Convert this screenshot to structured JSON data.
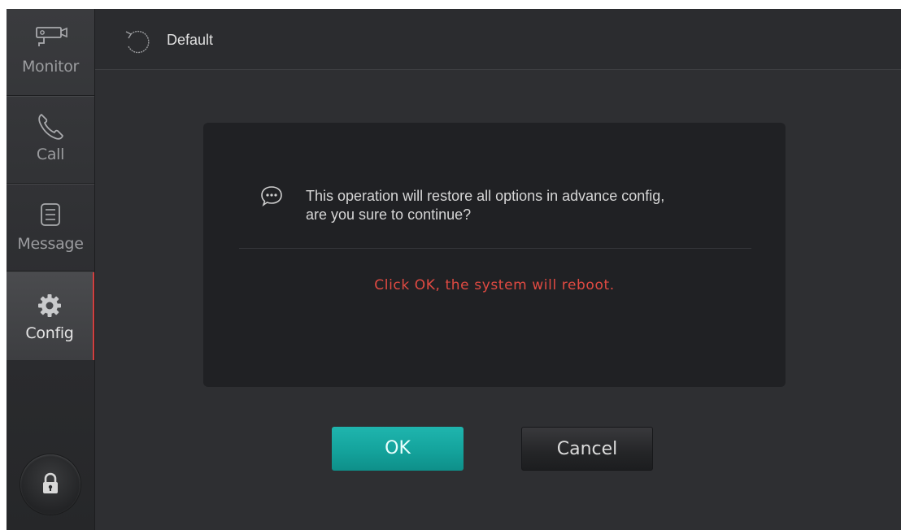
{
  "sidebar": {
    "items": [
      {
        "label": "Monitor",
        "icon": "camera-icon"
      },
      {
        "label": "Call",
        "icon": "phone-icon"
      },
      {
        "label": "Message",
        "icon": "message-list-icon"
      },
      {
        "label": "Config",
        "icon": "gear-icon",
        "active": true
      }
    ],
    "lock_icon": "lock-icon"
  },
  "header": {
    "title": "Default",
    "icon": "reset-icon"
  },
  "dialog": {
    "message_line1": "This operation will restore all options in advance config,",
    "message_line2": "are you sure to continue?",
    "warning": "Click OK, the system will reboot.",
    "icon": "chat-bubble-icon"
  },
  "buttons": {
    "ok_label": "OK",
    "cancel_label": "Cancel"
  },
  "colors": {
    "accent_active": "#d23f3f",
    "ok_button": "#14a39c",
    "warning_text": "#e04a42"
  }
}
